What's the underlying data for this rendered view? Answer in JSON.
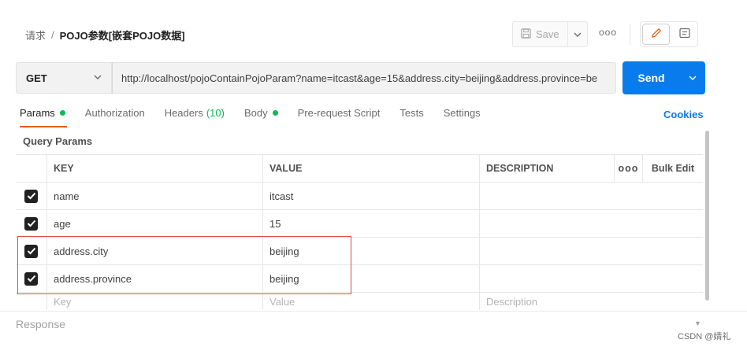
{
  "breadcrumb": {
    "parent": "请求",
    "separator": "/",
    "title": "POJO参数[嵌套POJO数据]"
  },
  "toolbar": {
    "save_label": "Save",
    "more_label": "ooo"
  },
  "request": {
    "method": "GET",
    "url": "http://localhost/pojoContainPojoParam?name=itcast&age=15&address.city=beijing&address.province=be",
    "send_label": "Send"
  },
  "tabs": [
    {
      "label": "Params",
      "active": true,
      "dot": true
    },
    {
      "label": "Authorization"
    },
    {
      "label": "Headers",
      "count": "(10)"
    },
    {
      "label": "Body",
      "dot": true
    },
    {
      "label": "Pre-request Script"
    },
    {
      "label": "Tests"
    },
    {
      "label": "Settings"
    }
  ],
  "cookies_label": "Cookies",
  "query_params": {
    "title": "Query Params",
    "columns": {
      "key": "KEY",
      "value": "VALUE",
      "description": "DESCRIPTION",
      "more": "ooo",
      "bulk_edit": "Bulk Edit"
    },
    "rows": [
      {
        "checked": true,
        "key": "name",
        "value": "itcast",
        "description": ""
      },
      {
        "checked": true,
        "key": "age",
        "value": "15",
        "description": ""
      },
      {
        "checked": true,
        "key": "address.city",
        "value": "beijing",
        "description": ""
      },
      {
        "checked": true,
        "key": "address.province",
        "value": "beijing",
        "description": ""
      }
    ],
    "placeholders": {
      "key": "Key",
      "value": "Value",
      "description": "Description"
    }
  },
  "response_label": "Response",
  "watermark": "CSDN @婧礼",
  "colors": {
    "accent": "#097bed",
    "active_tab": "#e8600f",
    "dot": "#0cbb52",
    "highlight": "#e34b4b"
  },
  "icons": [
    "save-icon",
    "chevron-down-icon",
    "pencil-icon",
    "comment-icon",
    "check-icon"
  ]
}
